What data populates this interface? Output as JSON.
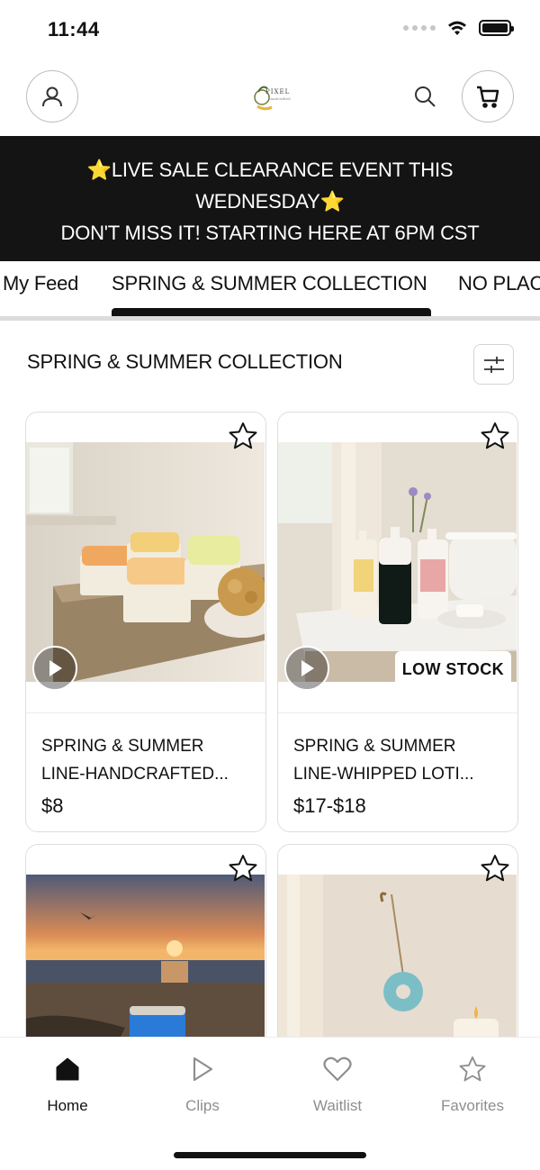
{
  "status": {
    "time": "11:44"
  },
  "header": {
    "logo_text": "PIXEL",
    "logo_sub": "handcrafted"
  },
  "banner": {
    "line1": "⭐LIVE SALE CLEARANCE EVENT THIS",
    "line2": "WEDNESDAY⭐",
    "line3": "DON'T MISS IT! STARTING HERE AT 6PM CST"
  },
  "tabs": [
    {
      "label": "My Feed"
    },
    {
      "label": "SPRING & SUMMER COLLECTION"
    },
    {
      "label": "NO PLAC"
    }
  ],
  "section": {
    "title": "SPRING & SUMMER COLLECTION"
  },
  "products": [
    {
      "name_line1": "SPRING & SUMMER",
      "name_line2": "LINE-HANDCRAFTED...",
      "price": "$8",
      "badge": ""
    },
    {
      "name_line1": "SPRING & SUMMER",
      "name_line2": "LINE-WHIPPED LOTI...",
      "price": "$17-$18",
      "badge": "LOW STOCK"
    }
  ],
  "nav": [
    {
      "label": "Home"
    },
    {
      "label": "Clips"
    },
    {
      "label": "Waitlist"
    },
    {
      "label": "Favorites"
    }
  ],
  "colors": {
    "banner_bg": "#141414",
    "accent": "#111111",
    "muted": "#8e8e8e"
  }
}
